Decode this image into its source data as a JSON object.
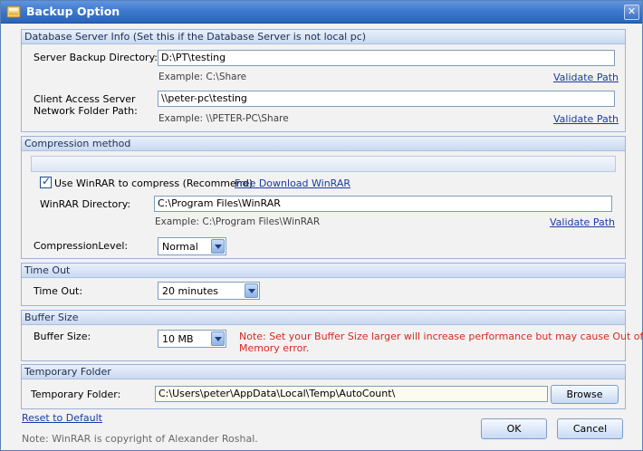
{
  "window": {
    "title": "Backup Option",
    "close_glyph": "✕"
  },
  "database": {
    "header": "Database Server Info (Set this if the Database Server is not local pc)",
    "server_label": "Server Backup Directory:",
    "server_value": "D:\\PT\\testing",
    "server_example": "Example: C:\\Share",
    "client_label_1": "Client Access Server",
    "client_label_2": "Network Folder Path:",
    "client_value": "\\\\peter-pc\\testing",
    "client_example": "Example: \\\\PETER-PC\\Share",
    "validate_label": "Validate Path"
  },
  "compression": {
    "header": "Compression method",
    "use_winrar_label": "Use WinRAR to compress (Recommend)",
    "use_winrar_checked": true,
    "download_link": "Free Download WinRAR",
    "dir_label": "WinRAR Directory:",
    "dir_value": "C:\\Program Files\\WinRAR",
    "dir_example": "Example: C:\\Program Files\\WinRAR",
    "validate_label": "Validate Path",
    "level_label": "CompressionLevel:",
    "level_value": "Normal"
  },
  "timeout": {
    "header": "Time Out",
    "label": "Time Out:",
    "value": "20 minutes"
  },
  "buffer": {
    "header": "Buffer Size",
    "label": "Buffer Size:",
    "value": "10 MB",
    "note_1": "Note: Set your Buffer Size larger will increase performance but may cause Out of",
    "note_2": "Memory error."
  },
  "temp": {
    "header": "Temporary Folder",
    "label": "Temporary Folder:",
    "value": "C:\\Users\\peter\\AppData\\Local\\Temp\\AutoCount\\",
    "browse_label": "Browse"
  },
  "footer": {
    "reset_label": "Reset to Default",
    "copyright_note": "Note: WinRAR is copyright of  Alexander Roshal.",
    "ok_label": "OK",
    "cancel_label": "Cancel"
  },
  "colors": {
    "title_bar": "#3f79cf",
    "warning_text": "#d42a1e",
    "link": "#1a3aa3"
  }
}
